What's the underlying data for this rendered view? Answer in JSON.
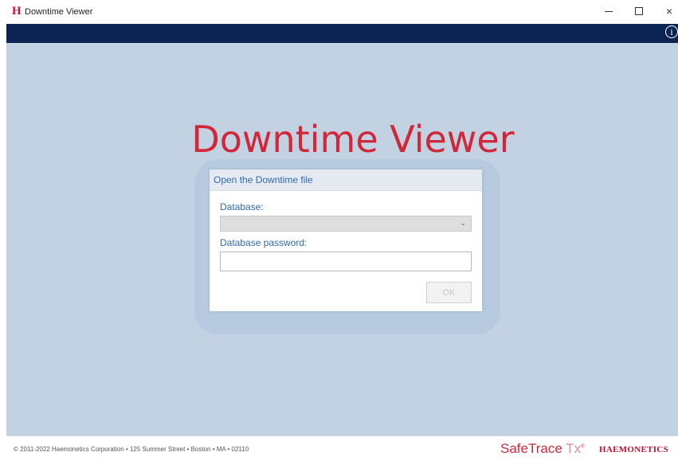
{
  "window": {
    "logo_letter": "H",
    "title": "Downtime Viewer",
    "controls": {
      "minimize": "–",
      "maximize": "☐",
      "close": "×"
    }
  },
  "header": {
    "info_glyph": "i"
  },
  "main": {
    "title": "Downtime Viewer",
    "dialog": {
      "title": "Open the Downtime file",
      "database_label": "Database:",
      "database_value": "",
      "password_label": "Database password:",
      "password_value": "",
      "ok_label": "OK"
    }
  },
  "footer": {
    "copyright": "© 2011-2022 Haemonetics Corporation • 125 Summer Street • Boston • MA • 02110",
    "brand_name": "SafeTrace",
    "brand_suffix": "Tx",
    "brand_mark": "®",
    "company": "HAEMONETICS"
  },
  "colors": {
    "navbar": "#0c2454",
    "background": "#c2d2e2",
    "accent_red": "#d0273a",
    "label_blue": "#2f6bb3"
  },
  "icons": [
    "app-logo-icon",
    "minimize-icon",
    "maximize-icon",
    "close-icon",
    "info-icon",
    "chevron-down-icon"
  ]
}
